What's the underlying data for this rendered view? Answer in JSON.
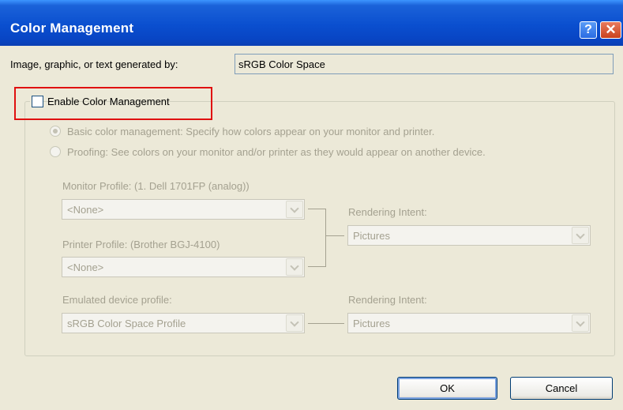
{
  "window": {
    "title": "Color Management"
  },
  "titlebar": {
    "help_glyph": "?",
    "close_glyph": "✕",
    "help_icon": "help-icon",
    "close_icon": "close-icon"
  },
  "generated_by": {
    "label": "Image, graphic, or text generated by:",
    "value": "sRGB Color Space"
  },
  "enable": {
    "label": "Enable Color Management",
    "checked": false
  },
  "modes": [
    {
      "label": "Basic color management: Specify how colors appear on your monitor and printer.",
      "selected": true
    },
    {
      "label": "Proofing: See colors on your monitor and/or printer as they would appear on another device.",
      "selected": false
    }
  ],
  "monitor": {
    "label": "Monitor Profile: (1. Dell 1701FP (analog))",
    "value": "<None>"
  },
  "printer": {
    "label": "Printer Profile: (Brother BGJ-4100)",
    "value": "<None>"
  },
  "rendering_1": {
    "label": "Rendering Intent:",
    "value": "Pictures"
  },
  "emulated": {
    "label": "Emulated device profile:",
    "value": "sRGB Color Space Profile"
  },
  "rendering_2": {
    "label": "Rendering Intent:",
    "value": "Pictures"
  },
  "buttons": {
    "ok": "OK",
    "cancel": "Cancel"
  },
  "colors": {
    "titlebar": "#0a4fcf",
    "dialog_bg": "#ece9d8",
    "disabled_text": "#a4a190",
    "highlight": "#e01010"
  }
}
